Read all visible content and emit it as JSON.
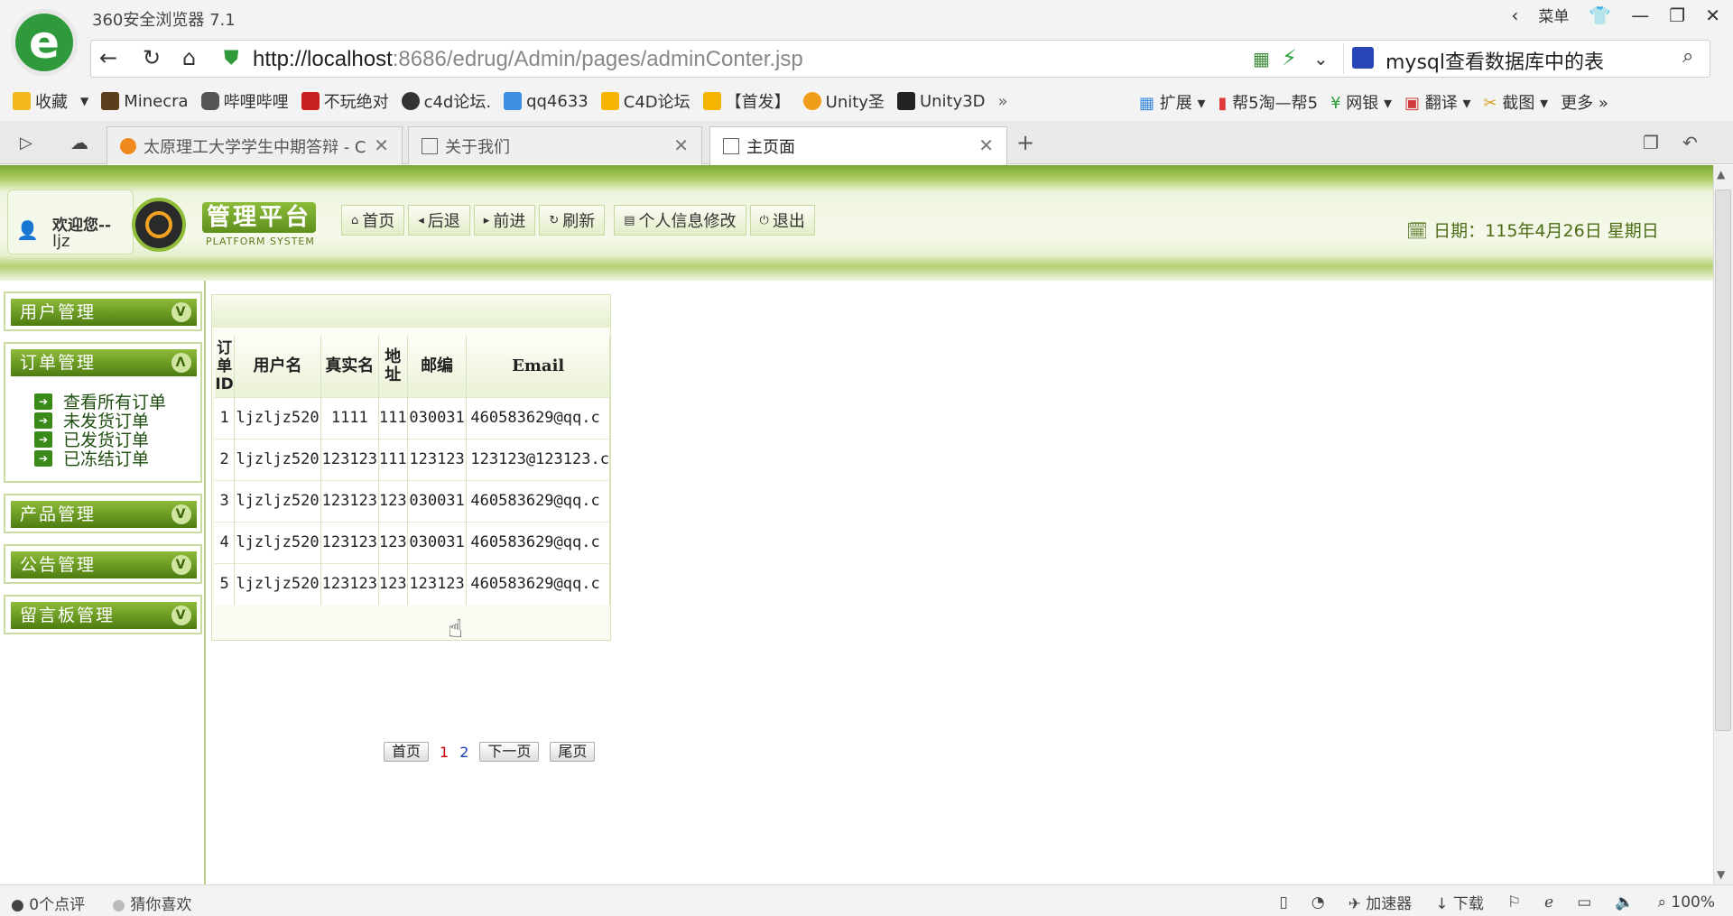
{
  "browser": {
    "app_title": "360安全浏览器 7.1",
    "menu_label": "菜单",
    "url_host": "http://localhost",
    "url_rest": ":8686/edrug/Admin/pages/adminConter.jsp",
    "search_text": "mysql查看数据库中的表"
  },
  "bookmarks": [
    "收藏",
    "Minecra",
    "哔哩哔哩",
    "不玩绝对",
    "c4d论坛.",
    "qq4633",
    "C4D论坛",
    "【首发】",
    "Unity圣",
    "Unity3D"
  ],
  "bookmarks_right": [
    "扩展",
    "帮5淘—帮5",
    "网银",
    "翻译",
    "截图",
    "更多"
  ],
  "tabs": [
    {
      "label": "太原理工大学学生中期答辩 - C"
    },
    {
      "label": "关于我们"
    },
    {
      "label": "主页面"
    }
  ],
  "header": {
    "welcome": "欢迎您--",
    "user": "ljz",
    "brand": "管理平台",
    "brand_sub": "PLATFORM SYSTEM",
    "date": "日期：115年4月26日 星期日"
  },
  "nav": [
    "首页",
    "后退",
    "前进",
    "刷新",
    "个人信息修改",
    "退出"
  ],
  "sidebar": {
    "user_mgmt": "用户管理",
    "order_mgmt": "订单管理",
    "order_items": [
      "查看所有订单",
      "未发货订单",
      "已发货订单",
      "已冻结订单"
    ],
    "product_mgmt": "产品管理",
    "notice_mgmt": "公告管理",
    "board_mgmt": "留言板管理",
    "collapsed_icon": "V",
    "expanded_icon": "Λ"
  },
  "table": {
    "headers": [
      "订单ID",
      "用户名",
      "真实名",
      "地址",
      "邮编",
      "Email"
    ],
    "rows": [
      [
        "1",
        "ljzljz520",
        "1111",
        "111",
        "030031",
        "460583629@qq.c"
      ],
      [
        "2",
        "ljzljz520",
        "123123",
        "111",
        "123123",
        "123123@123123.c"
      ],
      [
        "3",
        "ljzljz520",
        "123123",
        "123",
        "030031",
        "460583629@qq.c"
      ],
      [
        "4",
        "ljzljz520",
        "123123",
        "123",
        "030031",
        "460583629@qq.c"
      ],
      [
        "5",
        "ljzljz520",
        "123123",
        "123",
        "123123",
        "460583629@qq.c"
      ]
    ]
  },
  "pager": {
    "first": "首页",
    "p1": "1",
    "p2": "2",
    "next": "下一页",
    "last": "尾页"
  },
  "status": {
    "left1": "0个点评",
    "left2": "猜你喜欢",
    "accel": "加速器",
    "download": "下载",
    "zoom": "100%"
  }
}
